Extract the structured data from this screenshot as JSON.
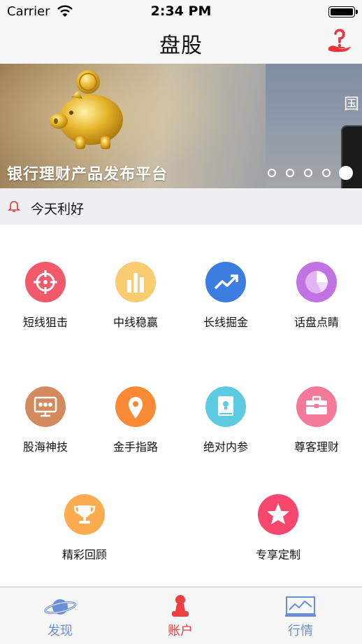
{
  "status_bar": {
    "carrier": "Carrier",
    "time": "2:34 PM"
  },
  "nav": {
    "title": "盘股",
    "help_icon": "help-hand-icon"
  },
  "banner": {
    "slides": [
      {
        "title": "银行理财产品发布平台",
        "image": "golden-piggy-bank"
      },
      {
        "title": "国",
        "image": "phone"
      }
    ],
    "page_count": 5,
    "active_page": 5
  },
  "notice": {
    "text": "今天利好",
    "icon": "bell-icon"
  },
  "grid": [
    {
      "label": "短线狙击",
      "icon": "crosshair-icon",
      "color": "#f25a6b"
    },
    {
      "label": "中线稳赢",
      "icon": "bar-chart-icon",
      "color": "#f9cc71"
    },
    {
      "label": "长线掘金",
      "icon": "trend-arrow-icon",
      "color": "#3c7de0"
    },
    {
      "label": "话盘点睛",
      "icon": "pie-chart-icon",
      "color": "#c173e3"
    },
    {
      "label": "股海神技",
      "icon": "presentation-icon",
      "color": "#d58a5d"
    },
    {
      "label": "金手指路",
      "icon": "location-pin-icon",
      "color": "#fb8a34"
    },
    {
      "label": "绝对内参",
      "icon": "book-icon",
      "color": "#5ccbe1"
    },
    {
      "label": "尊客理财",
      "icon": "briefcase-icon",
      "color": "#f57a99"
    },
    {
      "label": "精彩回顾",
      "icon": "trophy-icon",
      "color": "#fcab4f"
    },
    {
      "label": "专享定制",
      "icon": "star-icon",
      "color": "#f7476e"
    }
  ],
  "tabs": [
    {
      "label": "发现",
      "icon": "planet-icon",
      "color": "#6a8fd8"
    },
    {
      "label": "账户",
      "icon": "person-stamp-icon",
      "color": "#ee4040"
    },
    {
      "label": "行情",
      "icon": "monitor-chart-icon",
      "color": "#6a8fd8"
    }
  ]
}
